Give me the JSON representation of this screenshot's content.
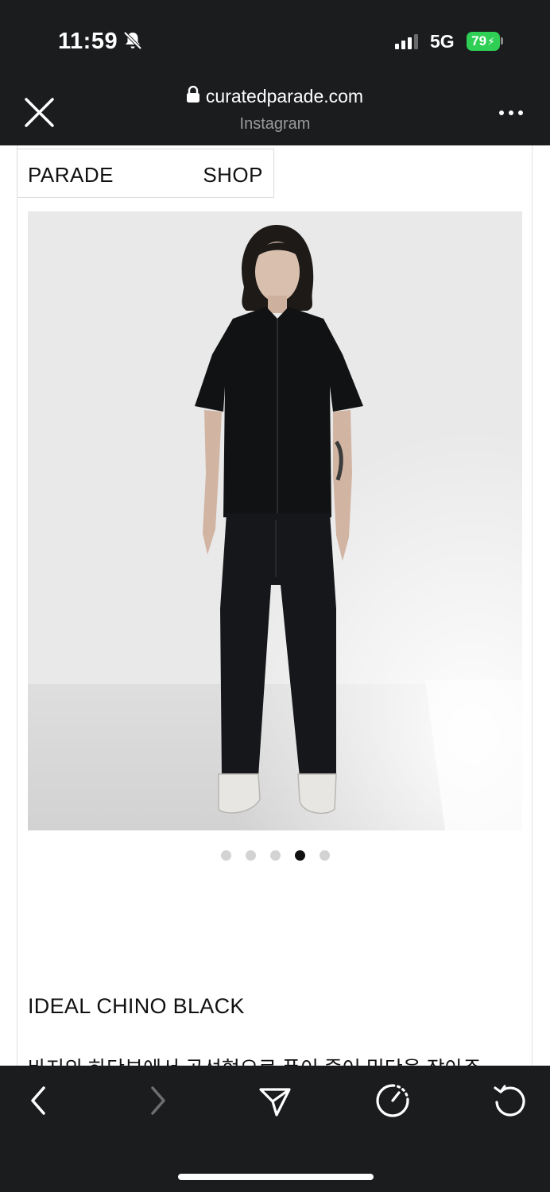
{
  "status_bar": {
    "time": "11:59",
    "network": "5G",
    "battery": "79"
  },
  "browser": {
    "url": "curatedparade.com",
    "subtitle": "Instagram"
  },
  "site_nav": {
    "brand": "PARADE",
    "shop": "SHOP"
  },
  "carousel": {
    "count": 5,
    "active_index": 3
  },
  "product": {
    "title": "IDEAL CHINO BLACK",
    "description": "바지의 하단부에서 곡선형으로 폭이 줄어 밑단을 잡아주"
  },
  "colors": {
    "chrome": "#1b1c1e",
    "battery": "#2fcf56"
  }
}
